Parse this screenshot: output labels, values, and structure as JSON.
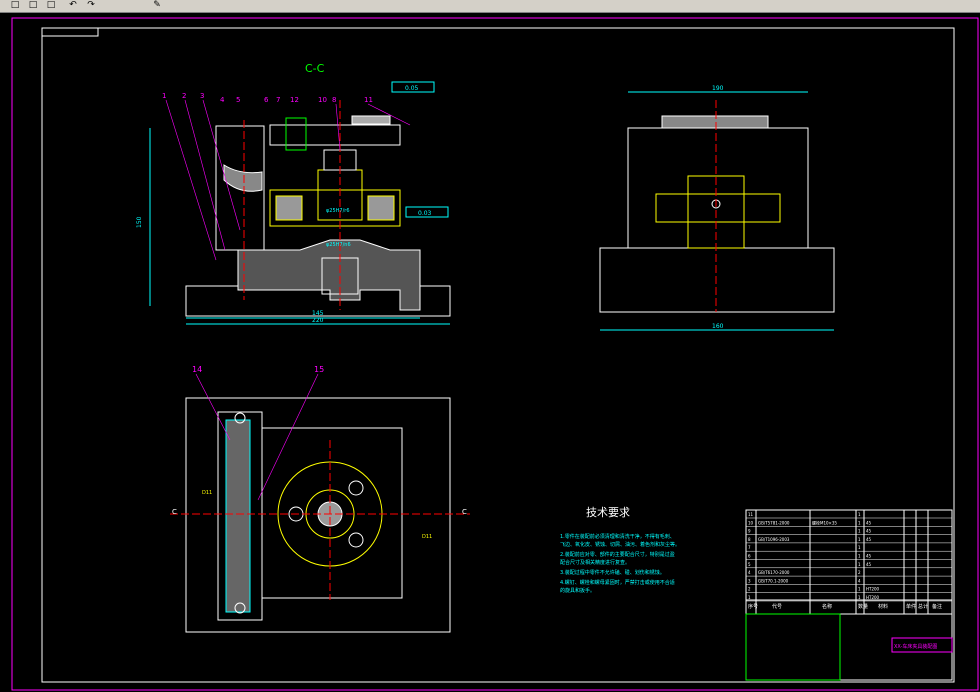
{
  "toolbar": {
    "icons": [
      "new-file-icon",
      "open-folder-icon",
      "save-icon",
      "undo-icon",
      "redo-icon",
      "brush-icon"
    ],
    "glyphs": [
      "□",
      "□",
      "□",
      "↶",
      "↷",
      "✎"
    ]
  },
  "drawing": {
    "section_label": "C-C",
    "part_numbers": [
      "1",
      "2",
      "3",
      "4",
      "5",
      "6",
      "7",
      "12",
      "10",
      "8",
      "11"
    ],
    "callouts_bottom": [
      "14",
      "15"
    ],
    "tolerances": [
      "0.05",
      "0.03"
    ],
    "fits": [
      "φ25H7/r6",
      "φ25H7/n6"
    ],
    "dims": [
      "150",
      "190",
      "145",
      "220",
      "160"
    ],
    "section_marks": [
      "C",
      "C"
    ],
    "cut_markers": [
      "D11",
      "D11"
    ]
  },
  "tech_req": {
    "title": "技术要求",
    "lines": [
      "1.零件在装配前必须清理和清洗干净，不得有毛刺、",
      "飞边、氧化皮、锈蚀、切屑、油污、着色剂和灰尘等。",
      "2.装配前应对零、部件的主要配合尺寸，特别是过盈",
      "配合尺寸及相关精度进行复查。",
      "3.装配过程中零件不允许磕、碰、划伤和锈蚀。",
      "4.螺钉、螺栓和螺母紧固时，严禁打击或使用不合适",
      "的旋具和扳手。"
    ]
  },
  "title_block": {
    "rows": [
      [
        "11",
        "",
        "",
        "1",
        ""
      ],
      [
        "10",
        "GB/T5781-2000",
        "螺栓M10×35",
        "1",
        "45"
      ],
      [
        "9",
        "",
        "",
        "1",
        "45"
      ],
      [
        "8",
        "GB/T1096-2003",
        "",
        "1",
        "45"
      ],
      [
        "7",
        "",
        "",
        "1",
        ""
      ],
      [
        "6",
        "",
        "",
        "1",
        "45"
      ],
      [
        "5",
        "",
        "",
        "1",
        "45"
      ],
      [
        "4",
        "GB/T6170-2000",
        "",
        "2",
        ""
      ],
      [
        "3",
        "GB/T70.1-2000",
        "",
        "4",
        ""
      ],
      [
        "2",
        "",
        "",
        "1",
        "HT200"
      ],
      [
        "1",
        "",
        "",
        "1",
        "HT200"
      ]
    ],
    "header": [
      "序号",
      "代号",
      "名称",
      "数量",
      "材料",
      "单件",
      "总计",
      "备注"
    ],
    "drawing_title": "XX-车床夹具装配图"
  },
  "colors": {
    "bg": "#000000",
    "frame": "#ffffff",
    "border": "#ff00ff",
    "dim": "#00ffff",
    "part": "#ffffff",
    "hatch": "#ffff00",
    "section": "#00ff00",
    "center": "#ff0000",
    "green": "#00ff00"
  }
}
